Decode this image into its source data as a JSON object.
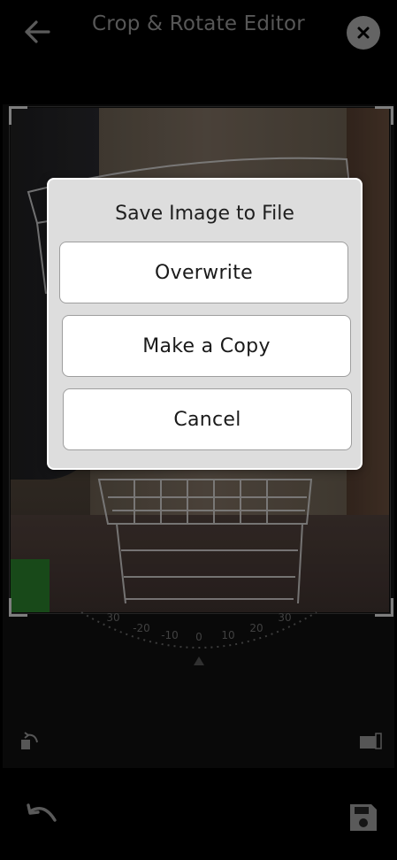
{
  "header": {
    "title": "Crop & Rotate Editor"
  },
  "dial": {
    "ticks": [
      "30",
      "-20",
      "-10",
      "0",
      "10",
      "20",
      "30"
    ]
  },
  "dialog": {
    "title": "Save Image to File",
    "buttons": {
      "overwrite": "Overwrite",
      "copy": "Make a Copy",
      "cancel": "Cancel"
    }
  },
  "colors": {
    "dialog_bg": "#dddddd",
    "button_bg": "#ffffff",
    "title_color": "#6b6b6b"
  },
  "icons": {
    "back": "arrow-left-icon",
    "close": "close-circle-icon",
    "rotate": "rotate-left-icon",
    "aspect": "aspect-ratio-icon",
    "undo": "undo-icon",
    "save": "floppy-disk-icon"
  }
}
